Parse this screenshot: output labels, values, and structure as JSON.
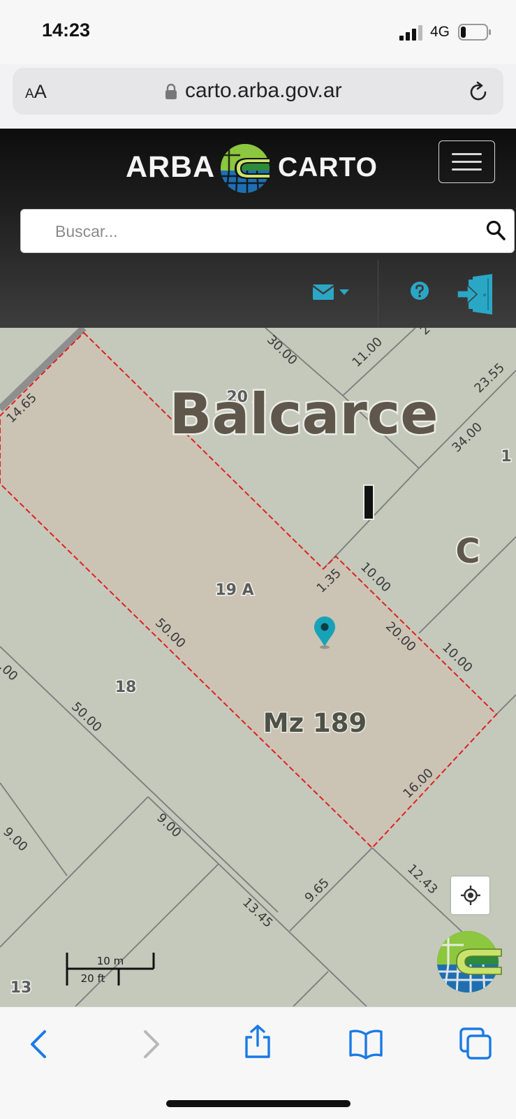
{
  "status_bar": {
    "time": "14:23",
    "network": "4G",
    "battery_level": 0.2
  },
  "browser": {
    "text_size_label_small": "A",
    "text_size_label_large": "A",
    "url": "carto.arba.gov.ar"
  },
  "header": {
    "logo_left": "ARBA",
    "logo_right": "CARTO",
    "search_placeholder": "Buscar..."
  },
  "map": {
    "city_label": "Balcarce",
    "partido_label": "I",
    "seccion_label": "C",
    "manzana_label": "Mz 189",
    "partial_label_top": "20 A",
    "partial_label_right": "1",
    "parcel_labels": [
      "19 A",
      "18",
      "13"
    ],
    "dimension_labels": [
      "30.00",
      "11.00",
      "23.55",
      "14.65",
      "34.00",
      "1.35",
      "10.00",
      "20.00",
      "10.00",
      "50.00",
      "50.00",
      ".00",
      "16.00",
      "9.00",
      "9.00",
      "13.45",
      "9.65",
      "12.43",
      "2"
    ],
    "scale": {
      "metric": "10 m",
      "imperial": "20 ft"
    },
    "colors": {
      "background": "#c4c9bb",
      "selected_parcel": "#cbc4b5",
      "selection_outline": "#e02020",
      "marker": "#17a2b8"
    }
  },
  "icons": {
    "signal": "signal-icon",
    "battery": "battery-icon",
    "lock": "lock-icon",
    "reload": "reload-icon",
    "menu": "hamburger-menu-icon",
    "search": "search-icon",
    "mail": "mail-icon",
    "help": "help-icon",
    "login": "login-door-icon",
    "locate": "locate-icon",
    "back": "back-icon",
    "forward": "forward-icon",
    "share": "share-icon",
    "bookmarks": "bookmarks-icon",
    "tabs": "tabs-icon"
  }
}
